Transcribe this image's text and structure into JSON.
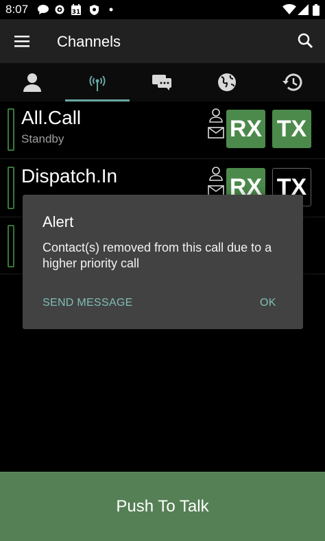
{
  "status_bar": {
    "time": "8:07",
    "icons": [
      "chat-bubble-icon",
      "gear-icon",
      "calendar-icon",
      "shield-icon",
      "dot-icon",
      "wifi-icon",
      "signal-icon",
      "battery-icon"
    ],
    "calendar_day": "31"
  },
  "appbar": {
    "title": "Channels"
  },
  "tabs": [
    {
      "name": "contacts",
      "icon": "person-icon",
      "selected": false
    },
    {
      "name": "channels",
      "icon": "radio-tower-icon",
      "selected": true
    },
    {
      "name": "messages",
      "icon": "chat-icon",
      "selected": false
    },
    {
      "name": "globe",
      "icon": "globe-icon",
      "selected": false
    },
    {
      "name": "history",
      "icon": "history-icon",
      "selected": false
    }
  ],
  "channels": [
    {
      "name": "All.Call",
      "status": "Standby",
      "rx_label": "RX",
      "tx_label": "TX",
      "rx_on": true,
      "tx_on": true
    },
    {
      "name": "Dispatch.In",
      "status": "",
      "rx_label": "RX",
      "tx_label": "TX",
      "rx_on": true,
      "tx_on": false
    }
  ],
  "dialog": {
    "title": "Alert",
    "message": "Contact(s) removed from this call due to a higher priority call",
    "negative_label": "SEND MESSAGE",
    "positive_label": "OK"
  },
  "ptt": {
    "label": "Push To Talk"
  },
  "colors": {
    "accent": "#7fbfb5",
    "tab_indicator": "#6aa9a4",
    "green": "#4c8a4c",
    "ptt_bg": "#558055",
    "dialog_bg": "#424242"
  }
}
